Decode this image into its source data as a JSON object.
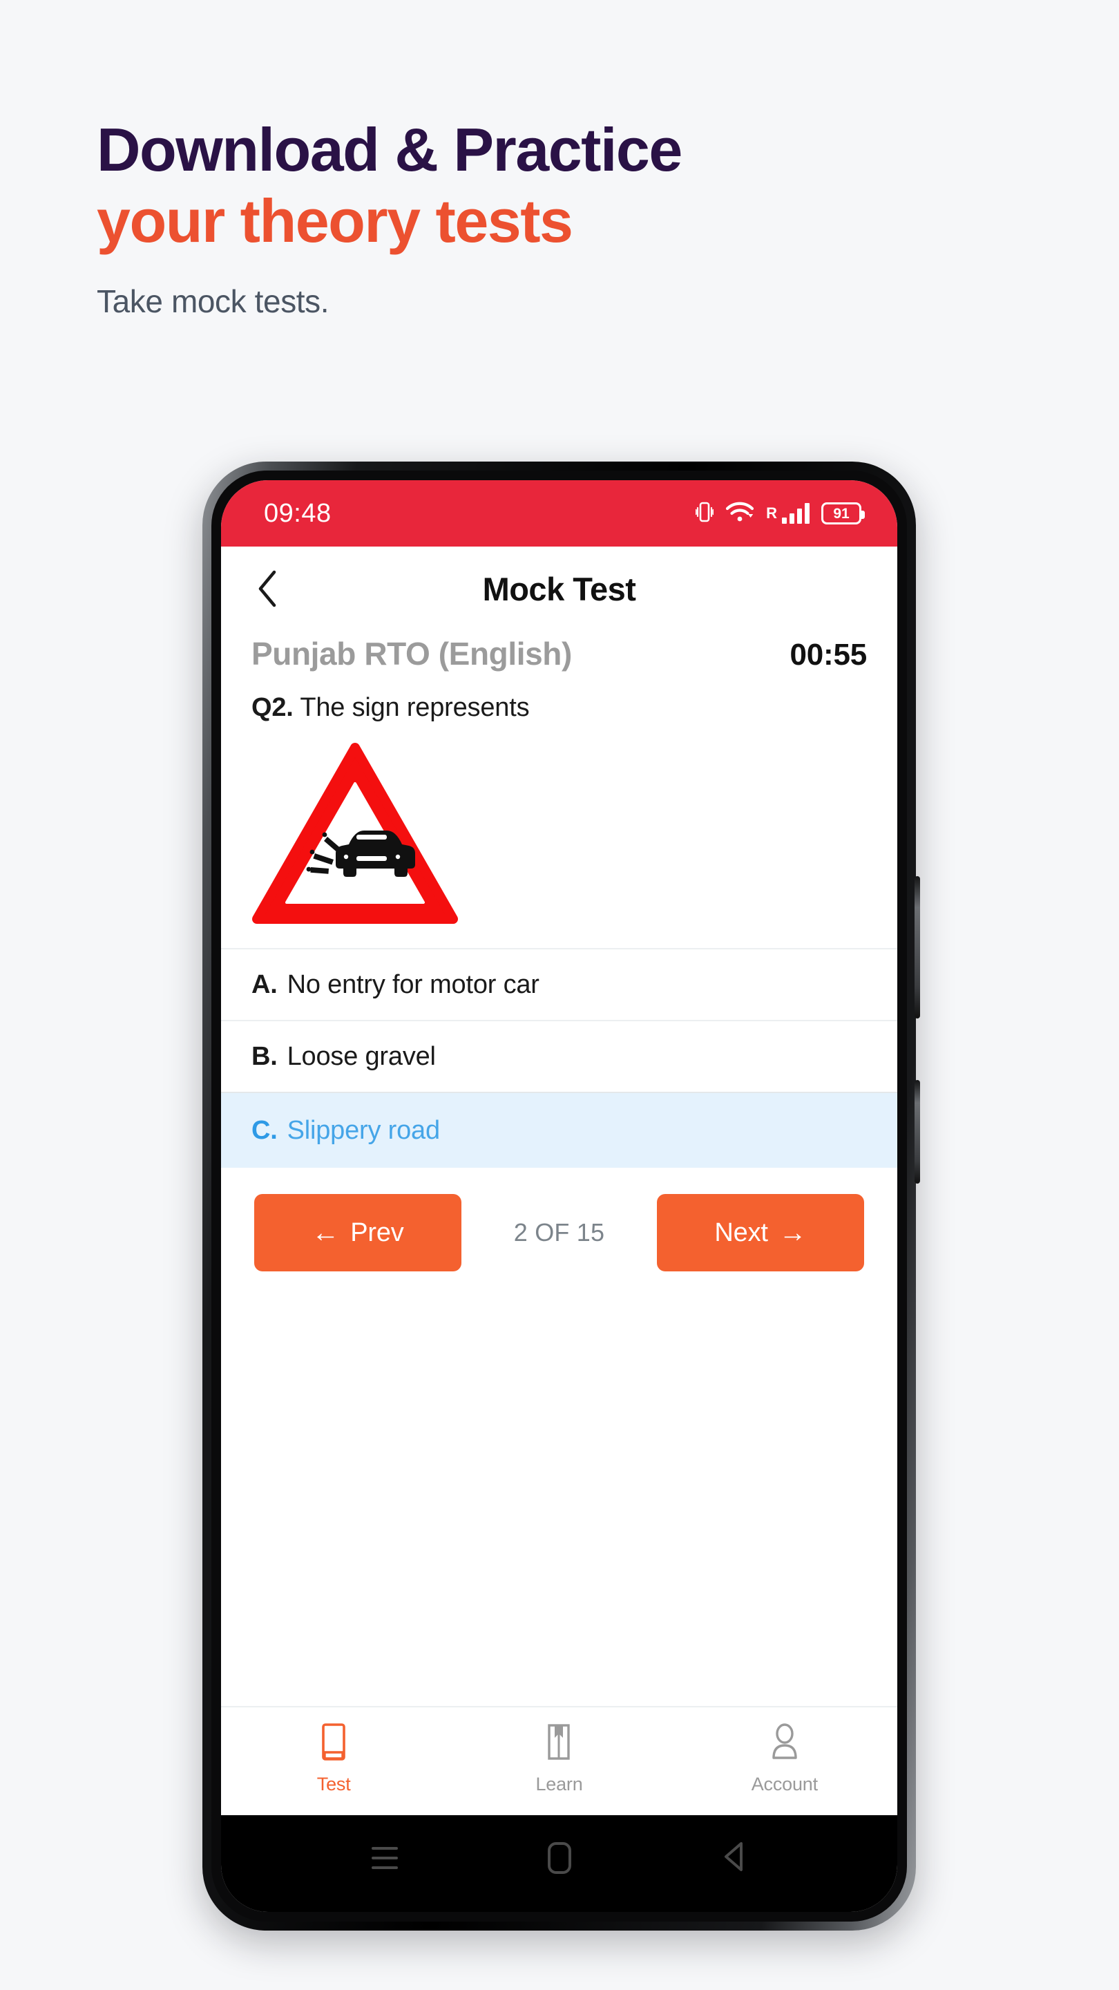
{
  "promo": {
    "headline_line1": "Download & Practice",
    "headline_line2": "your theory tests",
    "subtitle": "Take mock tests.",
    "color_line1": "#2a1246",
    "color_line2": "#ec5130"
  },
  "phone": {
    "status_bar": {
      "time": "09:48",
      "background_color": "#e8263b",
      "icons": [
        "vibrate-icon",
        "wifi-icon",
        "signal-icon",
        "battery-icon"
      ],
      "roaming_label": "R",
      "battery_level": "91"
    },
    "system_nav": {
      "recents_label": "recents",
      "home_label": "home",
      "back_label": "back"
    }
  },
  "app": {
    "appbar": {
      "back_icon": "chevron-left-icon",
      "title": "Mock Test"
    },
    "meta": {
      "rto_name": "Punjab RTO (English)",
      "timer": "00:55"
    },
    "question": {
      "number": "Q2.",
      "text": "The sign represents",
      "image_alt": "loose-gravel-warning-sign"
    },
    "options": [
      {
        "label": "A.",
        "text": "No entry for motor car",
        "selected": false
      },
      {
        "label": "B.",
        "text": "Loose gravel",
        "selected": false
      },
      {
        "label": "C.",
        "text": "Slippery road",
        "selected": true
      }
    ],
    "navigation": {
      "prev_label": "Prev",
      "prev_arrow": "←",
      "next_label": "Next",
      "next_arrow": "→",
      "counter": "2 OF 15",
      "button_color": "#f4612f"
    },
    "tabs": [
      {
        "label": "Test",
        "icon": "note-icon",
        "active": true
      },
      {
        "label": "Learn",
        "icon": "book-icon",
        "active": false
      },
      {
        "label": "Account",
        "icon": "person-icon",
        "active": false
      }
    ],
    "selected_option_bg": "#e4f2fd",
    "selected_option_color": "#45a5e8"
  }
}
